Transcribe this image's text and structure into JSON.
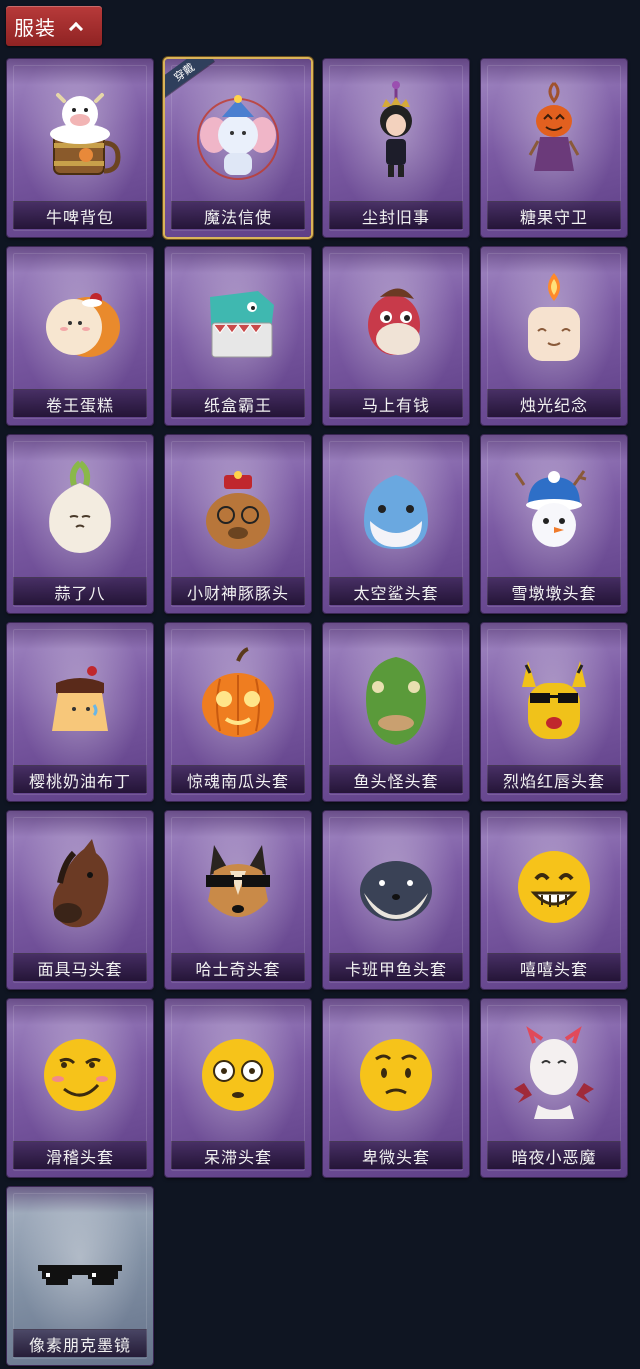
{
  "section": {
    "title": "服装"
  },
  "equipped_badge": "穿戴",
  "items": [
    {
      "label": "牛啤背包",
      "icon": "cow-beer-backpack-icon",
      "selected": false
    },
    {
      "label": "魔法信使",
      "icon": "magic-elephant-messenger-icon",
      "selected": true
    },
    {
      "label": "尘封旧事",
      "icon": "crowned-doll-charm-icon",
      "selected": false
    },
    {
      "label": "糖果守卫",
      "icon": "pumpkin-scarecrow-charm-icon",
      "selected": false
    },
    {
      "label": "卷王蛋糕",
      "icon": "roll-cake-icon",
      "selected": false
    },
    {
      "label": "纸盒霸王",
      "icon": "cardboard-dino-icon",
      "selected": false
    },
    {
      "label": "马上有钱",
      "icon": "red-horse-head-icon",
      "selected": false
    },
    {
      "label": "烛光纪念",
      "icon": "candle-head-icon",
      "selected": false
    },
    {
      "label": "蒜了八",
      "icon": "garlic-head-icon",
      "selected": false
    },
    {
      "label": "小财神豚豚头",
      "icon": "capybara-fortune-god-icon",
      "selected": false
    },
    {
      "label": "太空鲨头套",
      "icon": "space-shark-head-icon",
      "selected": false
    },
    {
      "label": "雪墩墩头套",
      "icon": "snowman-head-icon",
      "selected": false
    },
    {
      "label": "樱桃奶油布丁",
      "icon": "cherry-pudding-icon",
      "selected": false
    },
    {
      "label": "惊魂南瓜头套",
      "icon": "pumpkin-head-icon",
      "selected": false
    },
    {
      "label": "鱼头怪头套",
      "icon": "fish-head-mask-icon",
      "selected": false
    },
    {
      "label": "烈焰红唇头套",
      "icon": "yellow-mask-sunglasses-icon",
      "selected": false
    },
    {
      "label": "面具马头套",
      "icon": "horse-mask-icon",
      "selected": false
    },
    {
      "label": "哈士奇头套",
      "icon": "husky-sunglasses-icon",
      "selected": false
    },
    {
      "label": "卡班甲鱼头套",
      "icon": "seal-head-icon",
      "selected": false
    },
    {
      "label": "嘻嘻头套",
      "icon": "grinning-emoji-head-icon",
      "selected": false
    },
    {
      "label": "滑稽头套",
      "icon": "smirk-emoji-head-icon",
      "selected": false
    },
    {
      "label": "呆滞头套",
      "icon": "dazed-emoji-head-icon",
      "selected": false
    },
    {
      "label": "卑微头套",
      "icon": "pleading-emoji-head-icon",
      "selected": false
    },
    {
      "label": "暗夜小恶魔",
      "icon": "little-devil-head-icon",
      "selected": false
    },
    {
      "label": "像素朋克墨镜",
      "icon": "pixel-sunglasses-icon",
      "selected": false,
      "rarity": "gray"
    }
  ]
}
